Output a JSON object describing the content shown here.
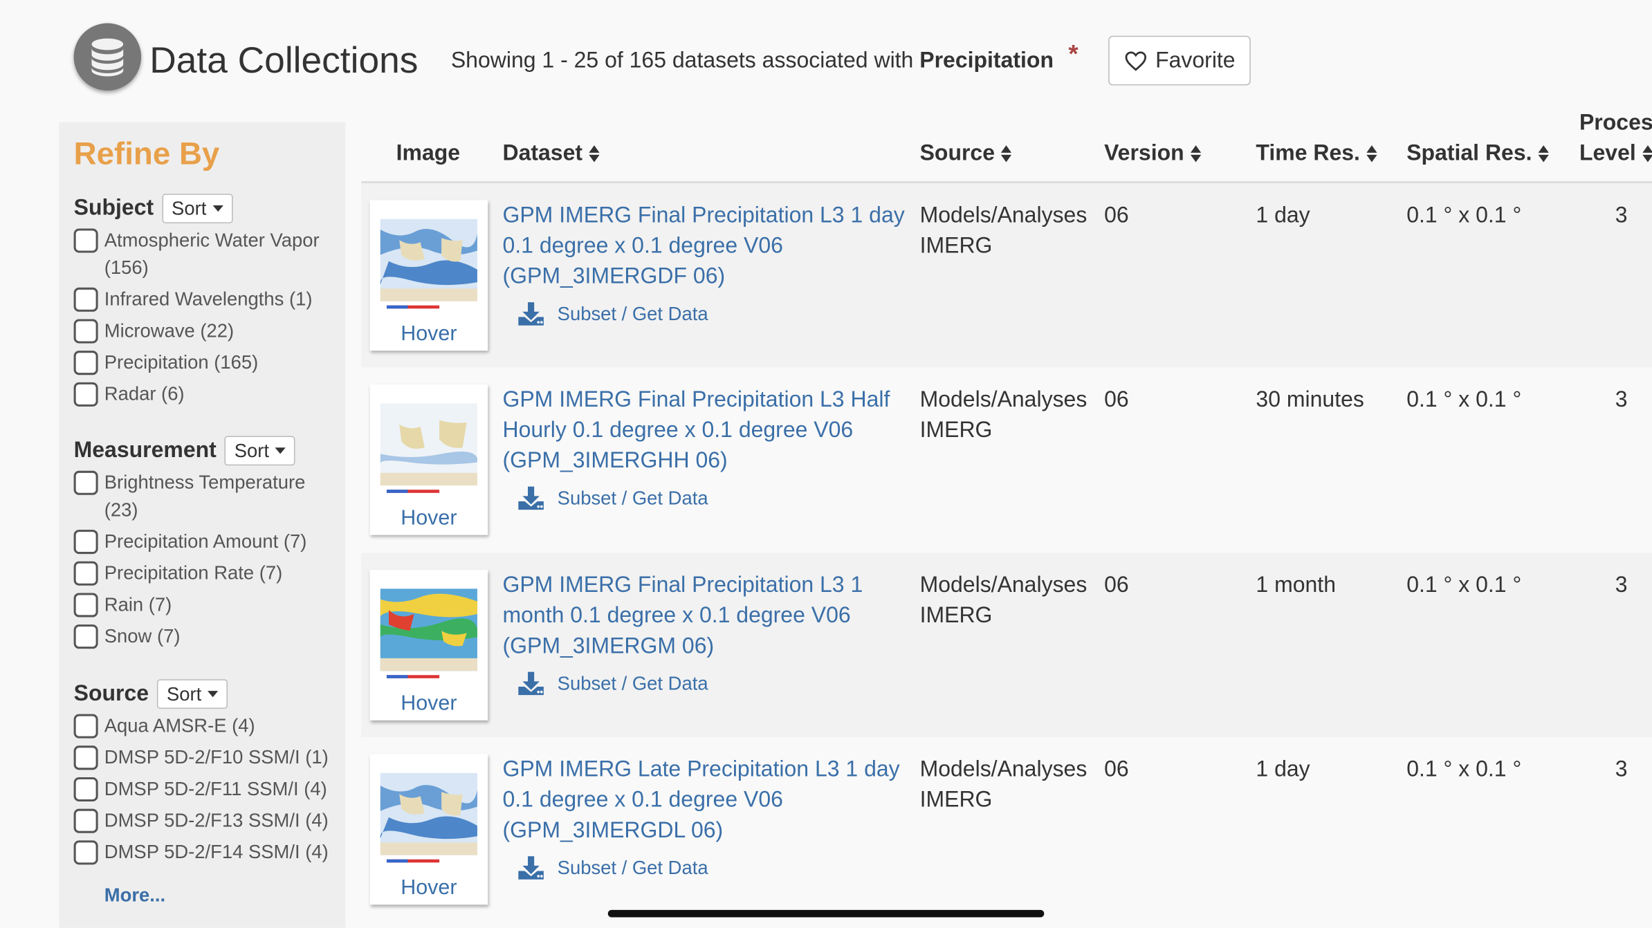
{
  "header": {
    "title": "Data Collections",
    "showing_prefix": "Showing 1 - 25 of 165 datasets associated with",
    "keyword": "Precipitation",
    "required_mark": "*",
    "favorite_label": "Favorite"
  },
  "sidebar": {
    "title": "Refine By",
    "sort_label": "Sort",
    "groups": [
      {
        "title": "Subject",
        "items": [
          "Atmospheric Water Vapor (156)",
          "Infrared Wavelengths (1)",
          "Microwave (22)",
          "Precipitation (165)",
          "Radar (6)"
        ]
      },
      {
        "title": "Measurement",
        "items": [
          "Brightness Temperature (23)",
          "Precipitation Amount (7)",
          "Precipitation Rate (7)",
          "Rain (7)",
          "Snow (7)"
        ]
      },
      {
        "title": "Source",
        "items": [
          "Aqua AMSR-E (4)",
          "DMSP 5D-2/F10 SSM/I (1)",
          "DMSP 5D-2/F11 SSM/I (4)",
          "DMSP 5D-2/F13 SSM/I (4)",
          "DMSP 5D-2/F14 SSM/I (4)"
        ]
      }
    ],
    "more_label": "More..."
  },
  "table": {
    "headers": {
      "image": "Image",
      "dataset": "Dataset",
      "source": "Source",
      "version": "Version",
      "time_res": "Time Res.",
      "spatial_res": "Spatial Res.",
      "proc_level_1": "Proces",
      "proc_level_2": "Level"
    },
    "rows": [
      {
        "thumb_label": "Hover",
        "dataset": "GPM IMERG Final Precipitation L3 1 day 0.1 degree x 0.1 degree V06 (GPM_3IMERGDF 06)",
        "get_data": "Subset / Get Data",
        "source_1": "Models/Analyses",
        "source_2": "IMERG",
        "version": "06",
        "time_res": "1 day",
        "spatial_res": "0.1 ° x 0.1 °",
        "level": "3"
      },
      {
        "thumb_label": "Hover",
        "dataset": "GPM IMERG Final Precipitation L3 Half Hourly 0.1 degree x 0.1 degree V06 (GPM_3IMERGHH 06)",
        "get_data": "Subset / Get Data",
        "source_1": "Models/Analyses",
        "source_2": "IMERG",
        "version": "06",
        "time_res": "30 minutes",
        "spatial_res": "0.1 ° x 0.1 °",
        "level": "3"
      },
      {
        "thumb_label": "Hover",
        "dataset": "GPM IMERG Final Precipitation L3 1 month 0.1 degree x 0.1 degree V06 (GPM_3IMERGM 06)",
        "get_data": "Subset / Get Data",
        "source_1": "Models/Analyses",
        "source_2": "IMERG",
        "version": "06",
        "time_res": "1 month",
        "spatial_res": "0.1 ° x 0.1 °",
        "level": "3"
      },
      {
        "thumb_label": "Hover",
        "dataset": "GPM IMERG Late Precipitation L3 1 day 0.1 degree x 0.1 degree V06 (GPM_3IMERGDL 06)",
        "get_data": "Subset / Get Data",
        "source_1": "Models/Analyses",
        "source_2": "IMERG",
        "version": "06",
        "time_res": "1 day",
        "spatial_res": "0.1 ° x 0.1 °",
        "level": "3"
      }
    ]
  },
  "colors": {
    "accent": "#e8a04a",
    "link": "#3a6fa8",
    "required": "#a94442"
  }
}
